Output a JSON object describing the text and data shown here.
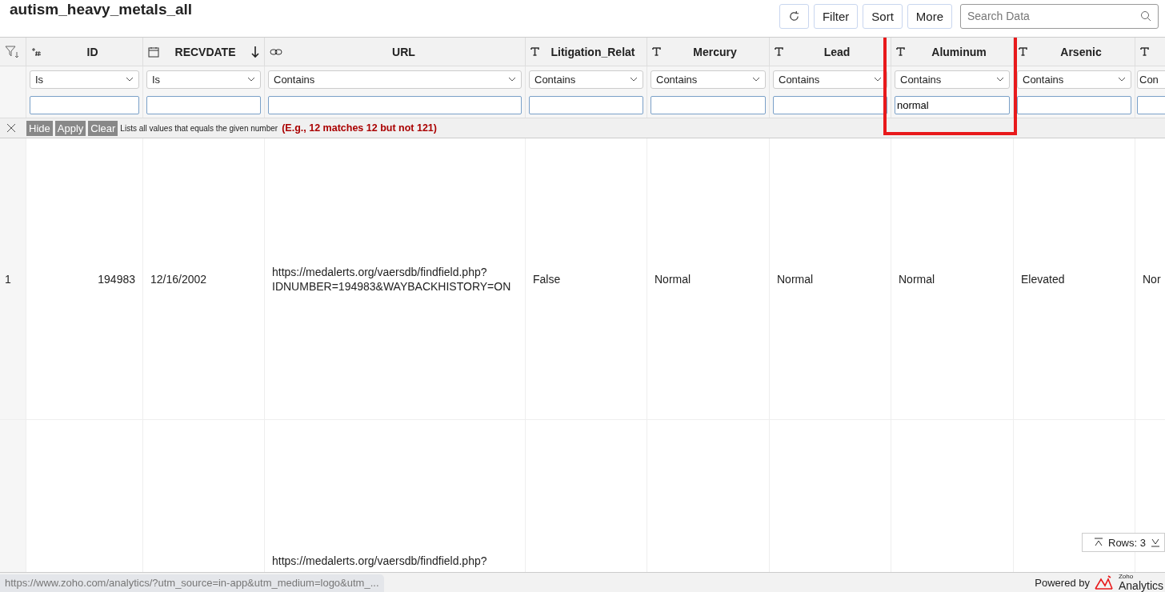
{
  "title": "autism_heavy_metals_all",
  "toolbar": {
    "buttons": [
      "Filter",
      "Sort",
      "More"
    ],
    "search": {
      "placeholder": "Search Data"
    }
  },
  "columns": [
    {
      "kind": "number",
      "label": "ID",
      "filter": "Is",
      "highlighted": false,
      "sorted": false
    },
    {
      "kind": "date",
      "label": "RECVDATE",
      "filter": "Is",
      "highlighted": false,
      "sorted": true
    },
    {
      "kind": "link",
      "label": "URL",
      "filter": "Contains",
      "highlighted": false,
      "sorted": false
    },
    {
      "kind": "text",
      "label": "Litigation_Relat",
      "filter": "Contains",
      "highlighted": false,
      "sorted": false
    },
    {
      "kind": "text",
      "label": "Mercury",
      "filter": "Contains",
      "highlighted": false,
      "sorted": false
    },
    {
      "kind": "text",
      "label": "Lead",
      "filter": "Contains",
      "highlighted": false,
      "sorted": false
    },
    {
      "kind": "text",
      "label": "Aluminum",
      "filter": "Contains",
      "value": "normal",
      "highlighted": true,
      "sorted": false
    },
    {
      "kind": "text",
      "label": "Arsenic",
      "filter": "Contains",
      "highlighted": false,
      "sorted": false
    },
    {
      "kind": "text",
      "filter": "Con",
      "highlighted": false,
      "sorted": false
    }
  ],
  "filter_bar": {
    "buttons": [
      "Hide",
      "Apply",
      "Clear"
    ],
    "hint": "Lists all values that equals the given number",
    "example": "(E.g., 12 matches 12 but not 121)"
  },
  "rows": [
    {
      "number": "1",
      "cells": [
        "194983",
        "12/16/2002",
        "https://medalerts.org/vaersdb/findfield.php? IDNUMBER=194983&WAYBACKHISTORY=ON",
        "False",
        "Normal",
        "Normal",
        "Normal",
        "Elevated",
        "Nor"
      ]
    },
    {
      "cells": [
        null,
        null,
        "https://medalerts.org/vaersdb/findfield.php?",
        null,
        null,
        null,
        null,
        null,
        null
      ]
    }
  ],
  "rows_widget": {
    "label": "Rows: 3"
  },
  "status_link": "https://www.zoho.com/analytics/?utm_source=in-app&utm_medium=logo&utm_...",
  "footer": {
    "powered_by": "Powered by",
    "brand_small": "Zoho",
    "brand": "Analytics"
  }
}
